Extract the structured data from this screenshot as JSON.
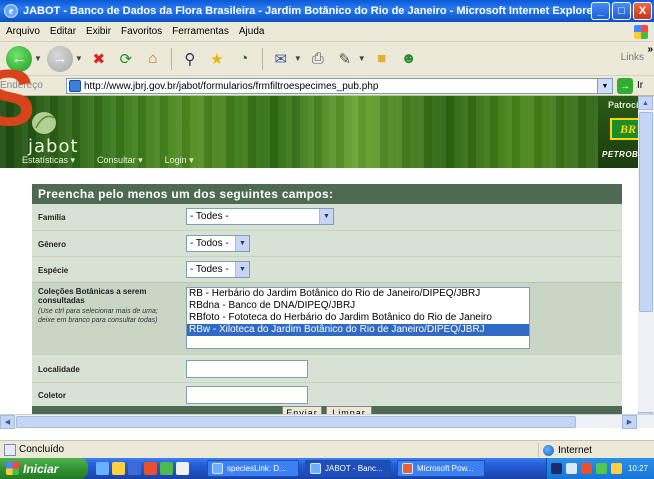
{
  "window": {
    "title": "JABOT - Banco de Dados da Flora Brasileira - Jardim Botânico do Rio de Janeiro - Microsoft Internet Explorer",
    "minimize": "_",
    "maximize": "□",
    "close": "X"
  },
  "menu": [
    "Arquivo",
    "Editar",
    "Exibir",
    "Favoritos",
    "Ferramentas",
    "Ajuda"
  ],
  "toolbar": {
    "links_label": "Links",
    "overflow": "»"
  },
  "address": {
    "label": "Endereço",
    "url": "http://www.jbrj.gov.br/jabot/formularios/frmfiltroespecimes_pub.php",
    "go_label": "Ir"
  },
  "banner": {
    "site_name": "jabot",
    "overlay_letter": "S",
    "nav": [
      "Estatísticas ▾",
      "Consultar ▾",
      "Login ▾"
    ],
    "sponsor_label": "Patrocínio",
    "sponsor_logo": "BR",
    "sponsor_name": "PETROBRA"
  },
  "form": {
    "heading": "Preencha pelo menos um dos seguintes campos:",
    "familia": {
      "label": "Família",
      "value": "- Todes -"
    },
    "genero": {
      "label": "Gênero",
      "value": "- Todos -"
    },
    "especie": {
      "label": "Espécie",
      "value": "- Todes -"
    },
    "colecoes": {
      "label": "Coleções Botânicas a serem consultadas",
      "hint": "(Use ctrl para selecionar mais de uma; deixe em branco para consultar todas)",
      "options": [
        "RB - Herbário do Jardim Botânico do Rio de Janeiro/DIPEQ/JBRJ",
        "RBdna - Banco de DNA/DIPEQ/JBRJ",
        "RBfoto - Fototeca do Herbário do Jardim Botânico do Rio de Janeiro",
        "RBw - Xiloteca do Jardim Botânico do Rio de Janeiro/DIPEQ/JBRJ"
      ],
      "selected_index": 3
    },
    "localidade": {
      "label": "Localidade",
      "value": ""
    },
    "coletor": {
      "label": "Coletor",
      "value": ""
    },
    "submit_label": "Enviar",
    "clear_label": "Limpar"
  },
  "status": {
    "text": "Concluído",
    "zone": "Internet"
  },
  "taskbar": {
    "start": "Iniciar",
    "tasks": [
      "speciesLink: D...",
      "JABOT - Banc...",
      "Microsoft Pow..."
    ],
    "clock": "10:27"
  }
}
